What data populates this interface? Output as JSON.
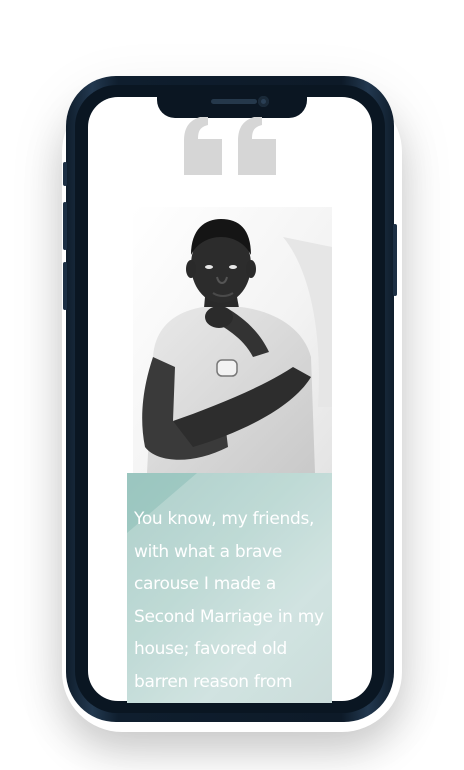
{
  "testimonial": {
    "text": "You know, my friends, with what a brave carouse I made a Second Marriage in my house; favored old barren reason from"
  },
  "icons": {
    "quote": "quote-mark-icon",
    "photo": "person-portrait"
  },
  "colors": {
    "phone_frame": "#0f1d2c",
    "quote_mark": "#d6d6d6",
    "card_gradient_start": "#a3cac4",
    "card_gradient_end": "#cbe0dd",
    "text": "#ffffff"
  }
}
